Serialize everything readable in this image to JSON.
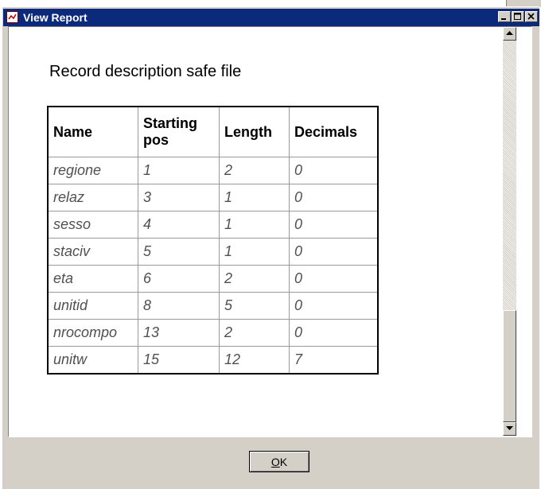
{
  "window": {
    "title": "View Report",
    "controls": [
      "minimize-icon",
      "maximize-icon",
      "close-icon"
    ]
  },
  "report": {
    "title": "Record description safe file",
    "columns": [
      {
        "line1": "Name",
        "line2": ""
      },
      {
        "line1": "Starting",
        "line2": "pos"
      },
      {
        "line1": "Length",
        "line2": ""
      },
      {
        "line1": "Decimals",
        "line2": ""
      }
    ],
    "rows": [
      [
        "regione",
        "1",
        "2",
        "0"
      ],
      [
        "relaz",
        "3",
        "1",
        "0"
      ],
      [
        "sesso",
        "4",
        "1",
        "0"
      ],
      [
        "staciv",
        "5",
        "1",
        "0"
      ],
      [
        "eta",
        "6",
        "2",
        "0"
      ],
      [
        "unitid",
        "8",
        "5",
        "0"
      ],
      [
        "nrocompo",
        "13",
        "2",
        "0"
      ],
      [
        "unitw",
        "15",
        "12",
        "7"
      ]
    ]
  },
  "buttons": {
    "ok_mnemonic": "O",
    "ok_rest": "K"
  },
  "colors": {
    "titlebar": "#0c2a7c",
    "chrome": "#d4d0c8",
    "cell_text": "#505050"
  }
}
